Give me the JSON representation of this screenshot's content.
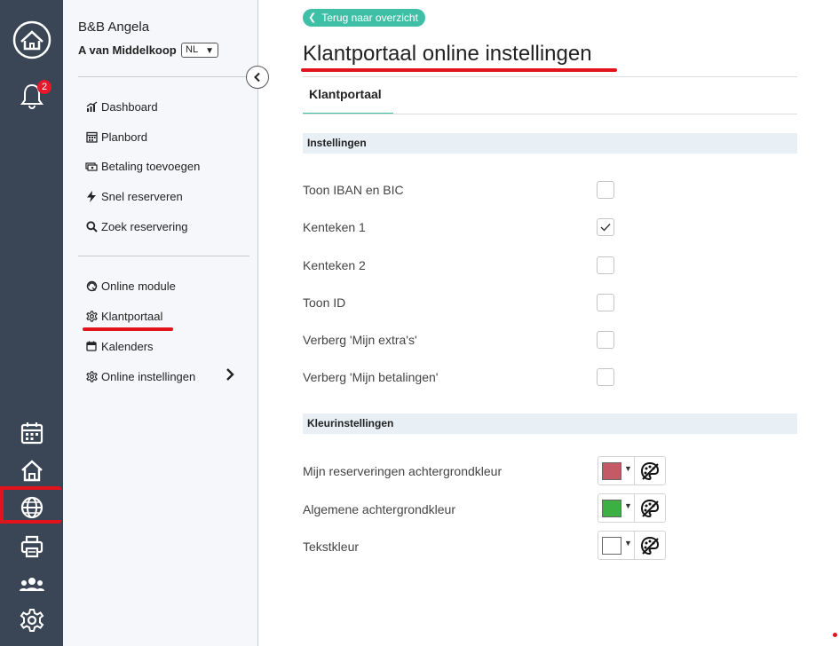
{
  "sidebar": {
    "property": "B&B Angela",
    "user": "A van Middelkoop",
    "language": "NL",
    "nav_primary": [
      {
        "label": "Dashboard",
        "icon": "chart-icon"
      },
      {
        "label": "Planbord",
        "icon": "calendar-grid-icon"
      },
      {
        "label": "Betaling toevoegen",
        "icon": "money-icon"
      },
      {
        "label": "Snel reserveren",
        "icon": "bolt-icon"
      },
      {
        "label": "Zoek reservering",
        "icon": "search-icon"
      }
    ],
    "nav_secondary": [
      {
        "label": "Online module",
        "icon": "online-module-icon"
      },
      {
        "label": "Klantportaal",
        "icon": "gear-icon"
      },
      {
        "label": "Kalenders",
        "icon": "calendar-icon"
      },
      {
        "label": "Online instellingen",
        "icon": "gear-icon"
      }
    ]
  },
  "rail": {
    "notification_count": "2",
    "icons": [
      "home-logo-icon",
      "bell-icon",
      "calendar-icon",
      "house-icon",
      "globe-icon",
      "printer-icon",
      "users-icon",
      "gear-icon"
    ]
  },
  "main": {
    "back_label": "Terug naar overzicht",
    "title": "Klantportaal online instellingen",
    "tab": "Klantportaal",
    "settings_header": "Instellingen",
    "settings": [
      {
        "label": "Toon IBAN en BIC",
        "checked": false
      },
      {
        "label": "Kenteken 1",
        "checked": true
      },
      {
        "label": "Kenteken 2",
        "checked": false
      },
      {
        "label": "Toon ID",
        "checked": false
      },
      {
        "label": "Verberg 'Mijn extra's'",
        "checked": false
      },
      {
        "label": "Verberg 'Mijn betalingen'",
        "checked": false
      }
    ],
    "colors_header": "Kleurinstellingen",
    "colors": [
      {
        "label": "Mijn reserveringen achtergrondkleur",
        "value": "#c45a66"
      },
      {
        "label": "Algemene achtergrondkleur",
        "value": "#3cb043"
      },
      {
        "label": "Tekstkleur",
        "value": "#ffffff"
      }
    ]
  },
  "theme": {
    "accent": "#3fbfa6",
    "rail_bg": "#3a4556",
    "highlight_red": "#e3131b"
  }
}
